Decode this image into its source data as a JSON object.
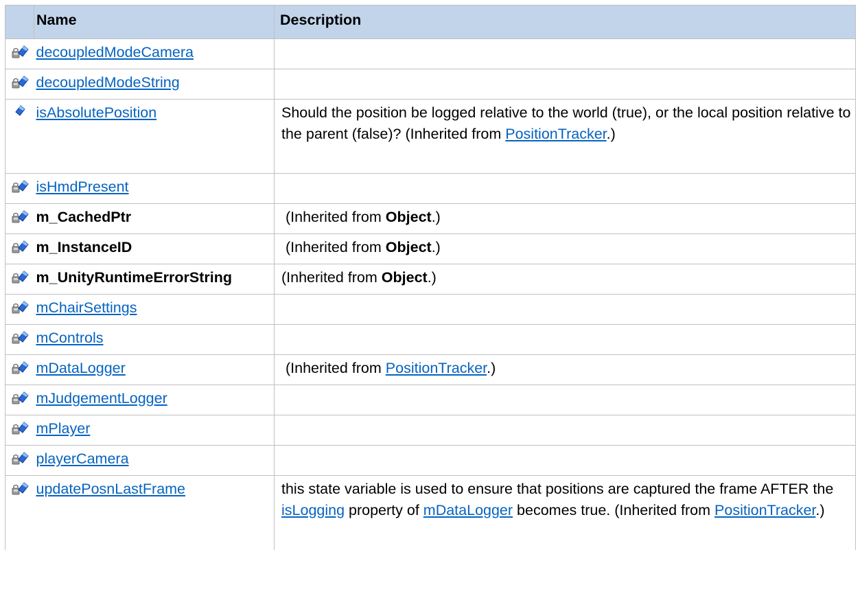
{
  "table": {
    "headers": {
      "name": "Name",
      "description": "Description"
    },
    "rows": [
      {
        "name": "decoupledModeCamera",
        "link": true
      },
      {
        "name": "decoupledModeString",
        "link": true
      },
      {
        "name": "isAbsolutePosition",
        "link": true,
        "description": "Should the position be logged relative to the world (true), or the local position relative to the parent (false)? (Inherited from ",
        "inherited_from": "PositionTracker",
        "tail": ".)"
      },
      {
        "name": "isHmdPresent",
        "link": true
      },
      {
        "name": "m_CachedPtr",
        "link": false,
        "description": "(Inherited from ",
        "inherited_from": "Object",
        "tail": ".)"
      },
      {
        "name": "m_InstanceID",
        "link": false,
        "description": "(Inherited from ",
        "inherited_from": "Object",
        "tail": ".)"
      },
      {
        "name": "m_UnityRuntimeErrorString",
        "link": false,
        "description": "(Inherited from ",
        "inherited_from": "Object",
        "tail": ".)"
      },
      {
        "name": "mChairSettings",
        "link": true
      },
      {
        "name": "mControls",
        "link": true
      },
      {
        "name": "mDataLogger",
        "link": true,
        "description": "(Inherited from ",
        "inherited_from": "PositionTracker",
        "tail": ".)"
      },
      {
        "name": "mJudgementLogger",
        "link": true
      },
      {
        "name": "mPlayer",
        "link": true
      },
      {
        "name": "playerCamera",
        "link": true
      },
      {
        "name": "updatePosnLastFrame",
        "link": true,
        "description_1": "this state variable is used to ensure that positions are captured the frame AFTER the ",
        "link_1": "isLogging",
        "description_2": " property of ",
        "link_2": "mDataLogger",
        "description_3": " becomes true. (Inherited from ",
        "inherited_from": "PositionTracker",
        "tail": ".)"
      }
    ]
  },
  "icons": {
    "protected_field": "protected-field-icon",
    "public_field": "public-field-icon"
  },
  "colors": {
    "header_bg": "#c1d4ea",
    "link": "#0563c1",
    "border": "#c0c0c0"
  }
}
